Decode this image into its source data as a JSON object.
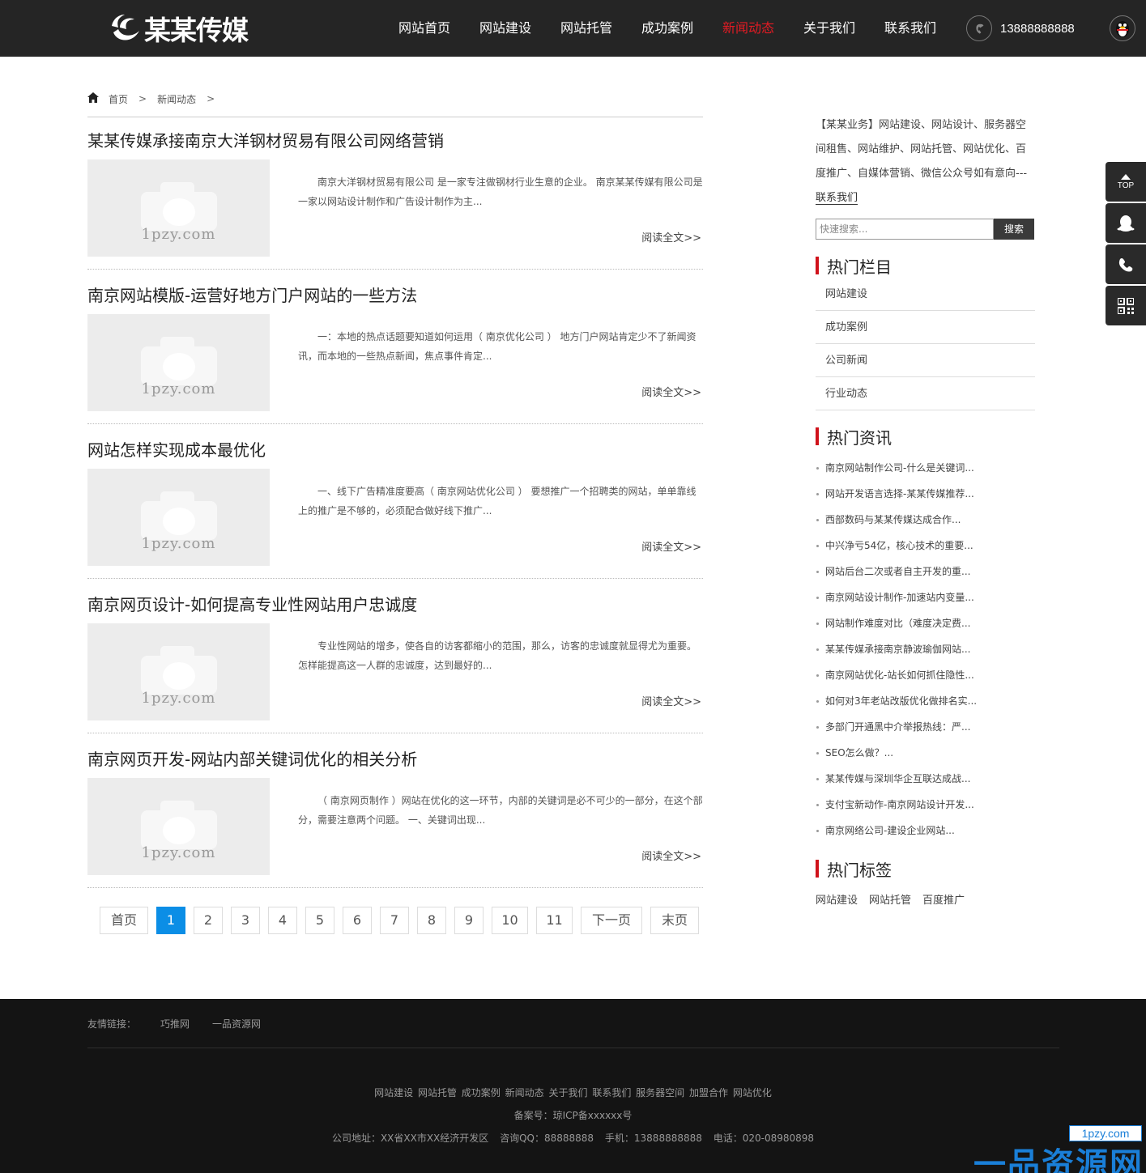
{
  "header": {
    "logo_text": "某某传媒",
    "nav": [
      "网站首页",
      "网站建设",
      "网站托管",
      "成功案例",
      "新闻动态",
      "关于我们",
      "联系我们"
    ],
    "active_nav": "新闻动态",
    "phone": "13888888888",
    "accent_color": "#e31b23"
  },
  "breadcrumb": {
    "home": "首页",
    "sep": ">",
    "current": "新闻动态"
  },
  "articles": [
    {
      "title": "某某传媒承接南京大洋钢材贸易有限公司网络营销",
      "thumb_watermark": "1pzy.com",
      "summary": "南京大洋钢材贸易有限公司 是一家专注做钢材行业生意的企业。 南京某某传媒有限公司是一家以网站设计制作和广告设计制作为主...",
      "read_more": "阅读全文>>"
    },
    {
      "title": "南京网站模版-运营好地方门户网站的一些方法",
      "thumb_watermark": "1pzy.com",
      "summary": "一：本地的热点话题要知道如何运用（ 南京优化公司 ） 地方门户网站肯定少不了新闻资讯，而本地的一些热点新闻，焦点事件肯定...",
      "read_more": "阅读全文>>"
    },
    {
      "title": "网站怎样实现成本最优化",
      "thumb_watermark": "1pzy.com",
      "summary": "一、线下广告精准度要高（ 南京网站优化公司 ） 要想推广一个招聘类的网站，单单靠线上的推广是不够的，必须配合做好线下推广...",
      "read_more": "阅读全文>>"
    },
    {
      "title": "南京网页设计-如何提高专业性网站用户忠诚度",
      "thumb_watermark": "1pzy.com",
      "summary": "专业性网站的增多，使各自的访客都缩小的范围，那么，访客的忠诚度就显得尤为重要。怎样能提高这一人群的忠诚度，达到最好的...",
      "read_more": "阅读全文>>"
    },
    {
      "title": "南京网页开发-网站内部关键词优化的相关分析",
      "thumb_watermark": "1pzy.com",
      "summary": "（ 南京网页制作 ）网站在优化的这一环节，内部的关键词是必不可少的一部分，在这个部分，需要注意两个问题。 一、关键词出现...",
      "read_more": "阅读全文>>"
    }
  ],
  "pagination": {
    "first": "首页",
    "pages": [
      "1",
      "2",
      "3",
      "4",
      "5",
      "6",
      "7",
      "8",
      "9",
      "10",
      "11"
    ],
    "active": "1",
    "next": "下一页",
    "last": "末页",
    "active_color": "#0b8ee6"
  },
  "sidebar": {
    "intro_prefix": "【某某业务】网站建设、网站设计、服务器空间租售、网站维护、网站托管、网站优化、百度推广、自媒体营销、微信公众号如有意向---",
    "intro_link": "联系我们",
    "search_placeholder": "快速搜索...",
    "search_button": "搜索",
    "hot_columns_title": "热门栏目",
    "hot_columns": [
      "网站建设",
      "成功案例",
      "公司新闻",
      "行业动态"
    ],
    "hot_news_title": "热门资讯",
    "hot_news": [
      "南京网站制作公司-什么是关键词...",
      "网站开发语言选择-某某传媒推荐...",
      "西部数码与某某传媒达成合作...",
      "中兴净亏54亿，核心技术的重要...",
      "网站后台二次或者自主开发的重...",
      "南京网站设计制作-加速站内变量...",
      "网站制作难度对比（难度决定费...",
      "某某传媒承接南京静波瑜伽网站...",
      "南京网站优化-站长如何抓住隐性...",
      "如何对3年老站改版优化做排名实...",
      "多部门开通黑中介举报热线：严...",
      "SEO怎么做？...",
      "某某传媒与深圳华企互联达成战...",
      "支付宝新动作-南京网站设计开发...",
      "南京网络公司-建设企业网站..."
    ],
    "hot_tags_title": "热门标签",
    "hot_tags": [
      "网站建设",
      "网站托管",
      "百度推广"
    ],
    "accent_color": "#d0121b"
  },
  "float_tools": {
    "top_label": "TOP"
  },
  "footer": {
    "friend_label": "友情链接：",
    "friend_links": [
      "巧推网",
      "一品资源网"
    ],
    "nav": [
      "网站建设",
      "网站托管",
      "成功案例",
      "新闻动态",
      "关于我们",
      "联系我们",
      "服务器空间",
      "加盟合作",
      "网站优化"
    ],
    "icp": "备案号：琼ICP备xxxxxx号",
    "address": "公司地址：XX省XX市XX经济开发区",
    "qq": "咨询QQ：88888888",
    "mobile": "手机：13888888888",
    "tel": "电话：020-08980898"
  },
  "watermark_logo": {
    "url": "1pzy.com",
    "text": "一品资源网"
  }
}
